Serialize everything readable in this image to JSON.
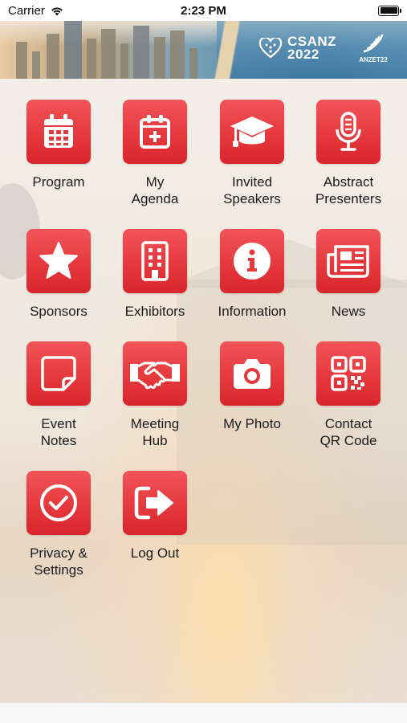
{
  "status_bar": {
    "carrier": "Carrier",
    "time": "2:23 PM"
  },
  "banner": {
    "csanz_line1": "CSANZ",
    "csanz_line2": "2022",
    "anzet_label": "ANZET22"
  },
  "colors": {
    "tile_red": "#e5393e",
    "icon_white": "#ffffff"
  },
  "tiles": [
    {
      "label_line1": "Program",
      "label_line2": "",
      "icon": "calendar-icon"
    },
    {
      "label_line1": "My",
      "label_line2": "Agenda",
      "icon": "calendar-plus-icon"
    },
    {
      "label_line1": "Invited",
      "label_line2": "Speakers",
      "icon": "graduation-cap-icon"
    },
    {
      "label_line1": "Abstract",
      "label_line2": "Presenters",
      "icon": "microphone-icon"
    },
    {
      "label_line1": "Sponsors",
      "label_line2": "",
      "icon": "star-icon"
    },
    {
      "label_line1": "Exhibitors",
      "label_line2": "",
      "icon": "building-icon"
    },
    {
      "label_line1": "Information",
      "label_line2": "",
      "icon": "info-icon"
    },
    {
      "label_line1": "News",
      "label_line2": "",
      "icon": "newspaper-icon"
    },
    {
      "label_line1": "Event",
      "label_line2": "Notes",
      "icon": "sticky-note-icon"
    },
    {
      "label_line1": "Meeting",
      "label_line2": "Hub",
      "icon": "handshake-icon"
    },
    {
      "label_line1": "My Photo",
      "label_line2": "",
      "icon": "camera-icon"
    },
    {
      "label_line1": "Contact",
      "label_line2": "QR Code",
      "icon": "qr-code-icon"
    },
    {
      "label_line1": "Privacy &",
      "label_line2": "Settings",
      "icon": "check-circle-icon"
    },
    {
      "label_line1": "Log Out",
      "label_line2": "",
      "icon": "logout-icon"
    }
  ]
}
